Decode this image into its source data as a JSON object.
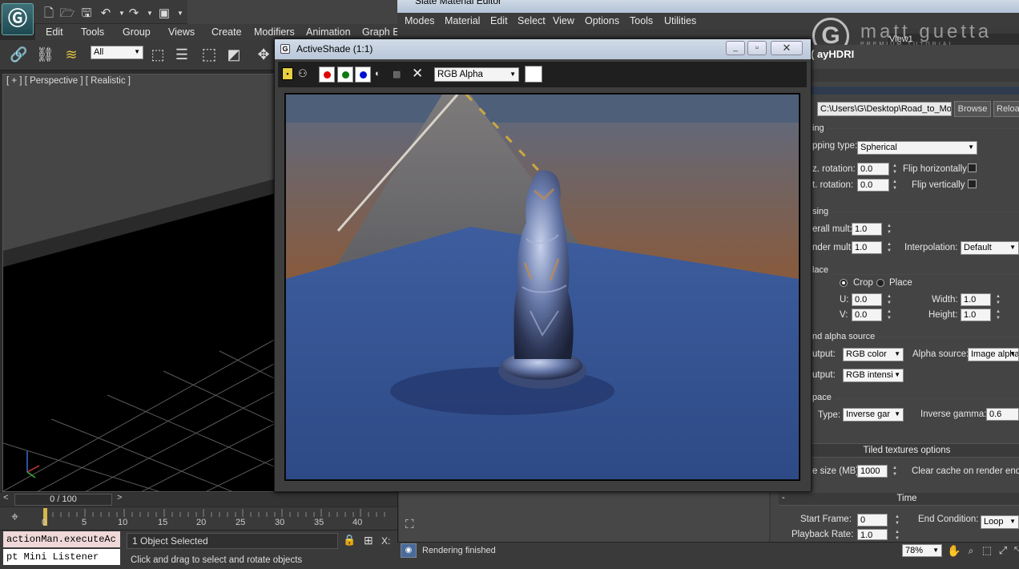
{
  "max": {
    "menu": [
      "Edit",
      "Tools",
      "Group",
      "Views",
      "Create",
      "Modifiers",
      "Animation",
      "Graph E"
    ],
    "selection_filter": "All",
    "viewport_label": "[ + ] [ Perspective ] [ Realistic ]",
    "time_slider": "0 / 100",
    "ticks": [
      "0",
      "5",
      "10",
      "15",
      "20",
      "25",
      "30",
      "35",
      "40"
    ],
    "script_line": "actionMan.executeAc",
    "mini_listener": "pt Mini Listener",
    "status_selected": "1 Object Selected",
    "x_label": "X:",
    "prompt": "Click and drag to select and rotate objects"
  },
  "slate": {
    "title": "Slate Material Editor",
    "menu": [
      "Modes",
      "Material",
      "Edit",
      "Select",
      "View",
      "Options",
      "Tools",
      "Utilities"
    ],
    "view_tab": "View1",
    "watermark": "matt guetta",
    "watermark_sub": "PREMIUM TUTORIAL",
    "status": "Rendering finished",
    "zoom": "78%"
  },
  "params": {
    "header": "ayHDRI )",
    "file_path": "C:\\Users\\G\\Desktop\\Road_to_Mor",
    "browse": "Browse",
    "reload": "Reloa",
    "mapping_group": "ing",
    "mapping_type_label": "pping type:",
    "mapping_type": "Spherical",
    "horiz_rotation_label": "z. rotation:",
    "horiz_rotation": "0.0",
    "flip_h_label": "Flip horizontally",
    "vert_rotation_label": "t. rotation:",
    "vert_rotation": "0.0",
    "flip_v_label": "Flip vertically",
    "processing_group": "sing",
    "overall_mult_label": "erall mult:",
    "overall_mult": "1.0",
    "render_mult_label": "nder mult:",
    "render_mult": "1.0",
    "interpolation_label": "Interpolation:",
    "interpolation": "Default",
    "crop_group": "lace",
    "crop": "Crop",
    "place": "Place",
    "u_label": "U:",
    "u": "0.0",
    "width_label": "Width:",
    "width": "1.0",
    "v_label": "V:",
    "v": "0.0",
    "height_label": "Height:",
    "height": "1.0",
    "rgb_alpha_group": "nd alpha source",
    "rgb_output_label": "utput:",
    "rgb_output": "RGB color",
    "alpha_source_label": "Alpha source:",
    "alpha_source": "Image alpha",
    "mono_output_label": "utput:",
    "mono_output": "RGB intensi",
    "color_space_group": "pace",
    "type_label": "Type:",
    "type": "Inverse gar",
    "inverse_gamma_label": "Inverse gamma:",
    "inverse_gamma": "0.6",
    "tiled_title": "Tiled textures options",
    "cache_size_label": "e size (MB):",
    "cache_size": "1000",
    "clear_cache_label": "Clear cache on render end",
    "time_title": "Time",
    "start_frame_label": "Start Frame:",
    "start_frame": "0",
    "end_condition_label": "End Condition:",
    "end_condition": "Loop",
    "playback_rate_label": "Playback Rate:",
    "playback_rate": "1.0"
  },
  "activeshade": {
    "title": "ActiveShade (1:1)",
    "channel": "RGB Alpha"
  },
  "colors": {
    "ui_background": "#3b3b3b",
    "titlebar": "#c6d2e2",
    "red_channel": "#e00000",
    "green_channel": "#0a7a10",
    "blue_channel": "#0010d0",
    "time_marker": "#d8b64a"
  }
}
